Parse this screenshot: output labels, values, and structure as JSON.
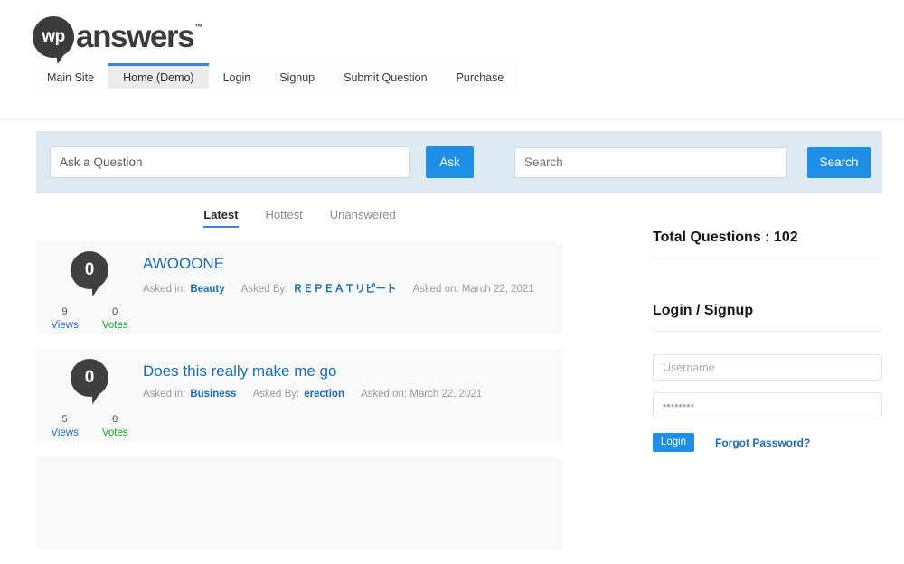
{
  "brand": {
    "bubble_text": "wp",
    "word": "answers",
    "tm": "™"
  },
  "nav": {
    "tabs": [
      {
        "label": "Main Site",
        "active": false
      },
      {
        "label": "Home (Demo)",
        "active": true
      },
      {
        "label": "Login",
        "active": false
      },
      {
        "label": "Signup",
        "active": false
      },
      {
        "label": "Submit Question",
        "active": false
      },
      {
        "label": "Purchase",
        "active": false
      }
    ]
  },
  "askbar": {
    "ask_placeholder": "Ask a Question",
    "ask_value": "",
    "ask_button": "Ask",
    "search_placeholder": "Search",
    "search_value": "",
    "search_button": "Search"
  },
  "filters": [
    {
      "label": "Latest",
      "active": true
    },
    {
      "label": "Hottest",
      "active": false
    },
    {
      "label": "Unanswered",
      "active": false
    }
  ],
  "questions": [
    {
      "answers": "0",
      "views": "9",
      "views_label": "Views",
      "votes": "0",
      "votes_label": "Votes",
      "title": "AWOOONE",
      "asked_in_label": "Asked in:",
      "category": "Beauty",
      "asked_by_label": "Asked By:",
      "author": "ＲＥＰＥＡＴリピート",
      "asked_on": "Asked on: March 22, 2021"
    },
    {
      "answers": "0",
      "views": "5",
      "views_label": "Views",
      "votes": "0",
      "votes_label": "Votes",
      "title": "Does this really make me go",
      "asked_in_label": "Asked in:",
      "category": "Business",
      "asked_by_label": "Asked By:",
      "author": "erection",
      "asked_on": "Asked on: March 22, 2021"
    }
  ],
  "sidebar": {
    "total_questions": "Total Questions : 102",
    "login_signup": "Login / Signup",
    "username_placeholder": "Username",
    "username_value": "",
    "password_placeholder": "••••••••",
    "password_value": "",
    "login_button": "Login",
    "forgot_password": "Forgot Password?"
  },
  "colors": {
    "accent_blue": "#1e8ee6",
    "link_blue": "#1e6bb8",
    "title_blue": "#1d6bb5",
    "votes_green": "#17a32c",
    "askbar_bg": "#dde9f3",
    "card_bg": "#f8f9fa",
    "bubble_dark": "#3f3f3f"
  }
}
